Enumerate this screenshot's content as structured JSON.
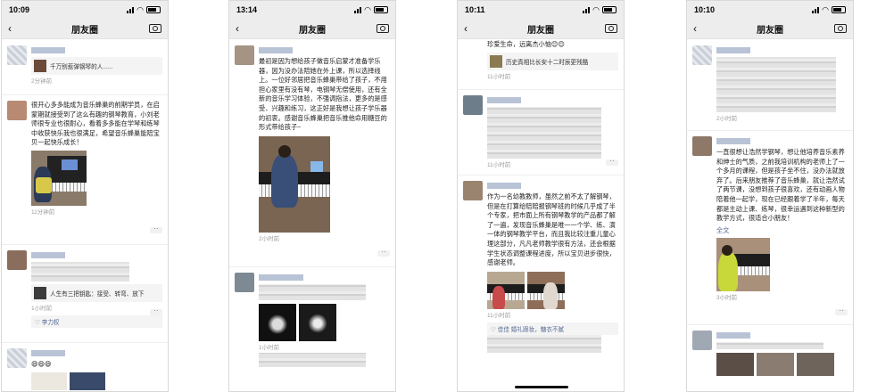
{
  "common": {
    "nav_title": "朋友圈",
    "back_glyph": "‹"
  },
  "phones": [
    {
      "status_time": "10:09",
      "posts": [
        {
          "share_text": "千万别惹弹钢琴的人......",
          "time": "2分钟前"
        },
        {
          "text": "很开心多多能成为音乐蜂巢的前期学员，在启蒙期就接受到了这么有趣的钢琴教育，小刘老师很专业也很耐心，看着多多能在学琴和练琴中收获快乐我也很满足，希望音乐蜂巢能陪宝贝一起快乐成长！",
          "time": "11分钟前"
        },
        {
          "share_text": "人生有三把钥匙：接受、转弯、放下",
          "time": "1小时前",
          "likes": "♡ 李力权"
        },
        {
          "emoji": "😄😄😄"
        }
      ]
    },
    {
      "status_time": "13:14",
      "posts": [
        {
          "text": "最初是因为想给孩子做音乐启蒙才准备学乐器，因为没办法陪她在外上课，所以选择线上。一位好邻居把音乐蜂巢带给了孩子，不用担心家里有没有琴，电钢琴无偿使用，还有全新的音乐学习体验，不强调指法，更多的是感受、兴趣和练习，这正好是我想让孩子学乐器的初衷。感谢音乐蜂巢把音乐推他命用糖豆的形式带给孩子~",
          "time": "2小时前"
        },
        {
          "time": "1小时前"
        }
      ]
    },
    {
      "status_time": "10:11",
      "posts": [
        {
          "text": "珍爱生命，远离杰小恼😊😊",
          "share_text": "历史真相比长安十二时辰更残酷",
          "time": "11小时前"
        },
        {
          "time": "11小时前"
        },
        {
          "text": "作为一名幼教教师，虽然之前不太了解钢琴，但是在打算给赔赔报钢琴班的时候几乎成了半个专家，把市面上所有钢琴教学的产品都了解了一遍，发现音乐蜂巢是唯一一个学、练、演一体的钢琴教学平台，而且我比较注重儿童心理这部分，凡凡老师教学很有方法，还会根据学生状态调整课程进度，所以宝贝进步很快，感谢老师。",
          "time": "11小时前",
          "likes": "♡ 佳佳 婚礼跟妆，糖衣不腻"
        }
      ]
    },
    {
      "status_time": "10:10",
      "posts": [
        {
          "time": "2小时前"
        },
        {
          "text": "一直很想让浩然学钢琴，想让他培养音乐素养和绅士的气质，之前我培训机构的老师上了一个多月的课程，但是孩子坐不住，没办法就放弃了。后来朋友推荐了音乐蜂巢，就让浩然试了两节课，没想到孩子很喜欢，还有动画人物陪着他一起学，现在已经跟着学了半年，每天都是主动上课、练琴，很幸运遇到这种新型的教学方式，很适合小朋友！",
          "full_text": "全文",
          "time": "3小时前"
        },
        {
          "time": ""
        }
      ]
    }
  ]
}
